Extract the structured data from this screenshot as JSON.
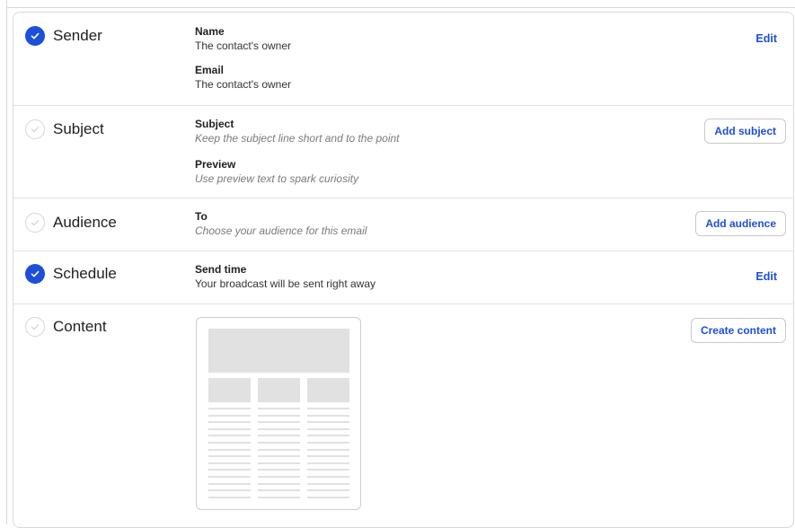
{
  "colors": {
    "accent": "#1d4fd8",
    "done_check": "#1d4fd8",
    "todo_circle": "#d6d6d6"
  },
  "rows": [
    {
      "id": "sender",
      "title": "Sender",
      "status": "done",
      "fields": [
        {
          "label": "Name",
          "value": "The contact's owner",
          "placeholder": false
        },
        {
          "label": "Email",
          "value": "The contact's owner",
          "placeholder": false
        }
      ],
      "action": {
        "label": "Edit",
        "style": "link"
      }
    },
    {
      "id": "subject",
      "title": "Subject",
      "status": "todo",
      "fields": [
        {
          "label": "Subject",
          "value": "Keep the subject line short and to the point",
          "placeholder": true
        },
        {
          "label": "Preview",
          "value": "Use preview text to spark curiosity",
          "placeholder": true
        }
      ],
      "action": {
        "label": "Add subject",
        "style": "button"
      }
    },
    {
      "id": "audience",
      "title": "Audience",
      "status": "todo",
      "fields": [
        {
          "label": "To",
          "value": "Choose your audience for this email",
          "placeholder": true
        }
      ],
      "action": {
        "label": "Add audience",
        "style": "button"
      }
    },
    {
      "id": "schedule",
      "title": "Schedule",
      "status": "done",
      "fields": [
        {
          "label": "Send time",
          "value": "Your broadcast will be sent right away",
          "placeholder": false
        }
      ],
      "action": {
        "label": "Edit",
        "style": "link"
      }
    },
    {
      "id": "content",
      "title": "Content",
      "status": "todo",
      "fields": [],
      "action": {
        "label": "Create content",
        "style": "button"
      },
      "preview": "email-template-placeholder"
    }
  ]
}
